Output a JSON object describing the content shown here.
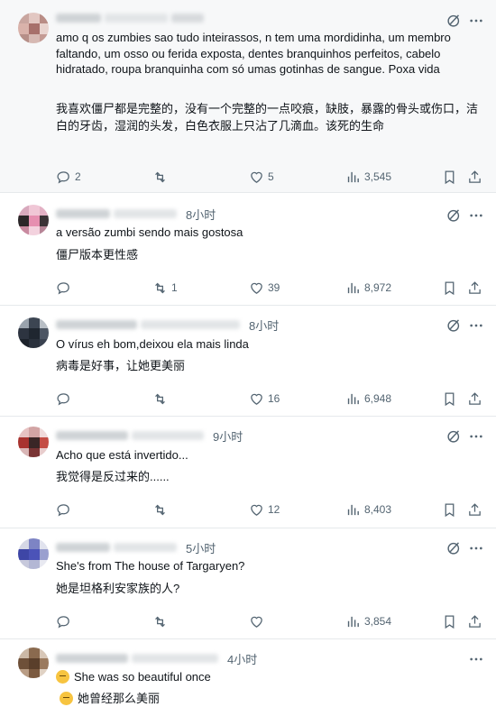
{
  "comments": [
    {
      "time": "",
      "text": "amo q os zumbies sao tudo inteirassos, n tem uma mordidinha, um membro faltando, um osso ou ferida exposta, dentes branquinhos perfeitos, cabelo hidratado, roupa branquinha com só umas gotinhas de sangue. Poxa vida",
      "translation": "我喜欢僵尸都是完整的，没有一个完整的一点咬痕，缺肢，暴露的骨头或伤口，洁白的牙齿，湿润的头发，白色衣服上只沾了几滴血。该死的生命",
      "replies": "2",
      "reposts": "",
      "likes": "5",
      "views": "3,545"
    },
    {
      "time": "8小时",
      "text": "a versão zumbi sendo mais gostosa",
      "translation": "僵尸版本更性感",
      "replies": "",
      "reposts": "1",
      "likes": "39",
      "views": "8,972"
    },
    {
      "time": "8小时",
      "text": "O vírus eh bom,deixou ela mais linda",
      "translation": "病毒是好事，让她更美丽",
      "replies": "",
      "reposts": "",
      "likes": "16",
      "views": "6,948"
    },
    {
      "time": "9小时",
      "text": "Acho que está invertido...",
      "translation": "我觉得是反过来的......",
      "replies": "",
      "reposts": "",
      "likes": "12",
      "views": "8,403"
    },
    {
      "time": "5小时",
      "text": "She's from The house of Targaryen?",
      "translation": "她是坦格利安家族的人?",
      "replies": "",
      "reposts": "",
      "likes": "",
      "views": "3,854"
    },
    {
      "time": "4小时",
      "text": "She was so beautiful once",
      "translation": "她曾经那么美丽",
      "replies": "",
      "reposts": "",
      "likes": "",
      "views": ""
    }
  ],
  "colors": {
    "text": "#0f1419",
    "muted": "#536471",
    "divider": "#e6e9ec",
    "shaded_bg": "#f7f8f9"
  },
  "icons": [
    "grok-icon",
    "more-icon",
    "reply-icon",
    "repost-icon",
    "like-icon",
    "views-icon",
    "bookmark-icon",
    "share-icon",
    "sad-face-emoji-icon"
  ]
}
